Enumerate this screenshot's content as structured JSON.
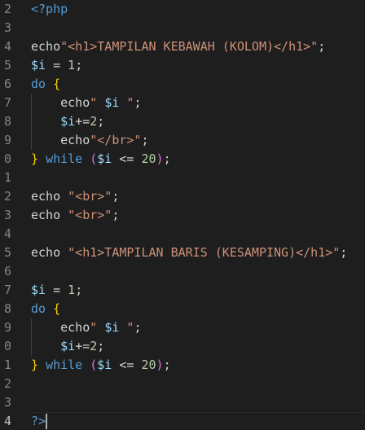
{
  "editor": {
    "colors": {
      "background": "#1e1e1e",
      "line_number": "#858585",
      "php_tag": "#569cd6",
      "string": "#ce9178",
      "variable": "#9cdcfe",
      "number": "#b5cea8",
      "keyword": "#c586c0",
      "bracket": "#ffd700"
    },
    "line_numbers": [
      "2",
      "3",
      "4",
      "5",
      "6",
      "7",
      "8",
      "9",
      "0",
      "1",
      "2",
      "3",
      "4",
      "5",
      "6",
      "7",
      "8",
      "9",
      "0",
      "1",
      "2",
      "3",
      "4"
    ],
    "lines": [
      {
        "tokens": [
          {
            "t": "delim",
            "v": "<?php"
          }
        ]
      },
      {
        "tokens": []
      },
      {
        "tokens": [
          {
            "t": "plain",
            "v": "echo"
          },
          {
            "t": "str",
            "v": "\"<h1>TAMPILAN KEBAWAH (KOLOM)</h1>\""
          },
          {
            "t": "plain",
            "v": ";"
          }
        ]
      },
      {
        "tokens": [
          {
            "t": "var",
            "v": "$i"
          },
          {
            "t": "plain",
            "v": " = "
          },
          {
            "t": "num",
            "v": "1"
          },
          {
            "t": "plain",
            "v": ";"
          }
        ]
      },
      {
        "tokens": [
          {
            "t": "ctl",
            "v": "do"
          },
          {
            "t": "plain",
            "v": " "
          },
          {
            "t": "brace",
            "v": "{"
          }
        ]
      },
      {
        "tokens": [
          {
            "t": "plain",
            "v": "    echo"
          },
          {
            "t": "str",
            "v": "\" "
          },
          {
            "t": "var",
            "v": "$i"
          },
          {
            "t": "str",
            "v": " \""
          },
          {
            "t": "plain",
            "v": ";"
          }
        ]
      },
      {
        "tokens": [
          {
            "t": "plain",
            "v": "    "
          },
          {
            "t": "var",
            "v": "$i"
          },
          {
            "t": "plain",
            "v": "+="
          },
          {
            "t": "num",
            "v": "2"
          },
          {
            "t": "plain",
            "v": ";"
          }
        ]
      },
      {
        "tokens": [
          {
            "t": "plain",
            "v": "    echo"
          },
          {
            "t": "str",
            "v": "\"</br>\""
          },
          {
            "t": "plain",
            "v": ";"
          }
        ]
      },
      {
        "tokens": [
          {
            "t": "brace",
            "v": "}"
          },
          {
            "t": "plain",
            "v": " "
          },
          {
            "t": "ctl",
            "v": "while"
          },
          {
            "t": "plain",
            "v": " "
          },
          {
            "t": "paren",
            "v": "("
          },
          {
            "t": "var",
            "v": "$i"
          },
          {
            "t": "plain",
            "v": " <= "
          },
          {
            "t": "num",
            "v": "20"
          },
          {
            "t": "paren",
            "v": ")"
          },
          {
            "t": "plain",
            "v": ";"
          }
        ]
      },
      {
        "tokens": []
      },
      {
        "tokens": [
          {
            "t": "plain",
            "v": "echo "
          },
          {
            "t": "str",
            "v": "\"<br>\""
          },
          {
            "t": "plain",
            "v": ";"
          }
        ]
      },
      {
        "tokens": [
          {
            "t": "plain",
            "v": "echo "
          },
          {
            "t": "str",
            "v": "\"<br>\""
          },
          {
            "t": "plain",
            "v": ";"
          }
        ]
      },
      {
        "tokens": []
      },
      {
        "tokens": [
          {
            "t": "plain",
            "v": "echo "
          },
          {
            "t": "str",
            "v": "\"<h1>TAMPILAN BARIS (KESAMPING)</h1>\""
          },
          {
            "t": "plain",
            "v": ";"
          }
        ]
      },
      {
        "tokens": []
      },
      {
        "tokens": [
          {
            "t": "var",
            "v": "$i"
          },
          {
            "t": "plain",
            "v": " = "
          },
          {
            "t": "num",
            "v": "1"
          },
          {
            "t": "plain",
            "v": ";"
          }
        ]
      },
      {
        "tokens": [
          {
            "t": "ctl",
            "v": "do"
          },
          {
            "t": "plain",
            "v": " "
          },
          {
            "t": "brace",
            "v": "{"
          }
        ]
      },
      {
        "tokens": [
          {
            "t": "plain",
            "v": "    echo"
          },
          {
            "t": "str",
            "v": "\" "
          },
          {
            "t": "var",
            "v": "$i"
          },
          {
            "t": "str",
            "v": " \""
          },
          {
            "t": "plain",
            "v": ";"
          }
        ]
      },
      {
        "tokens": [
          {
            "t": "plain",
            "v": "    "
          },
          {
            "t": "var",
            "v": "$i"
          },
          {
            "t": "plain",
            "v": "+="
          },
          {
            "t": "num",
            "v": "2"
          },
          {
            "t": "plain",
            "v": ";"
          }
        ]
      },
      {
        "tokens": [
          {
            "t": "brace",
            "v": "}"
          },
          {
            "t": "plain",
            "v": " "
          },
          {
            "t": "ctl",
            "v": "while"
          },
          {
            "t": "plain",
            "v": " "
          },
          {
            "t": "paren",
            "v": "("
          },
          {
            "t": "var",
            "v": "$i"
          },
          {
            "t": "plain",
            "v": " <= "
          },
          {
            "t": "num",
            "v": "20"
          },
          {
            "t": "paren",
            "v": ")"
          },
          {
            "t": "plain",
            "v": ";"
          }
        ]
      },
      {
        "tokens": []
      },
      {
        "tokens": []
      },
      {
        "tokens": [
          {
            "t": "delim",
            "v": "?>"
          }
        ],
        "cursor": true,
        "active": true
      }
    ]
  }
}
